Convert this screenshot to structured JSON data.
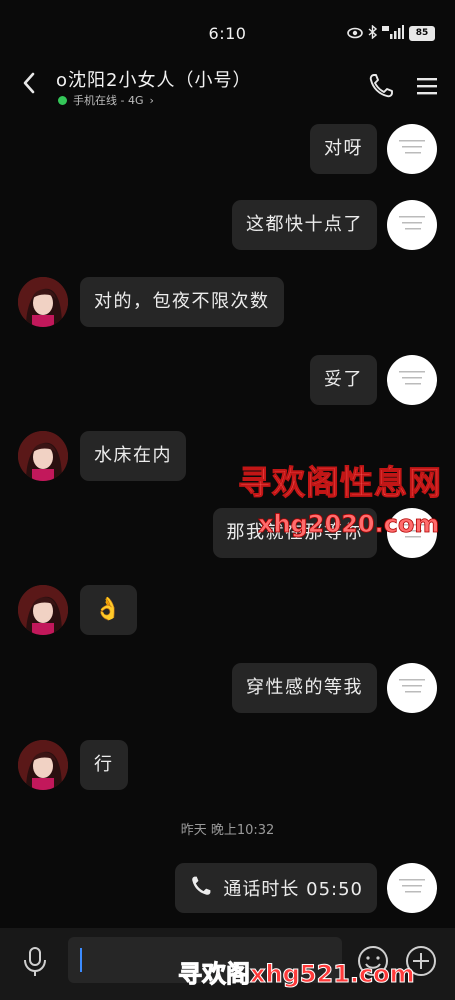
{
  "status_bar": {
    "time": "6:10",
    "battery": "85"
  },
  "header": {
    "title": "o沈阳2小女人（小号）",
    "subtitle": "手机在线 - 4G",
    "subtitle_chevron": "›"
  },
  "messages": [
    {
      "from": "me",
      "text": "对呀"
    },
    {
      "from": "me",
      "text": "这都快十点了"
    },
    {
      "from": "peer",
      "text": "对的，包夜不限次数"
    },
    {
      "from": "me",
      "text": "妥了"
    },
    {
      "from": "peer",
      "text": "水床在内"
    },
    {
      "from": "me",
      "text": "那我就在那等你"
    },
    {
      "from": "peer",
      "text": "👌"
    },
    {
      "from": "me",
      "text": "穿性感的等我"
    },
    {
      "from": "peer",
      "text": "行"
    }
  ],
  "time_divider": "昨天 晚上10:32",
  "call_record": {
    "icon": "phone-call-icon",
    "label": "通话时长 05:50"
  },
  "input": {
    "value": ""
  },
  "watermarks": {
    "site_name": "寻欢阁性息网",
    "site_url": "xhg2020.com",
    "bottom_banner": "寻欢阁xhg521.com"
  },
  "icons": [
    "back-arrow-icon",
    "phone-icon",
    "menu-icon",
    "microphone-icon",
    "emoji-icon",
    "plus-icon",
    "eye-icon",
    "bluetooth-icon",
    "signal-icon"
  ],
  "colors": {
    "background": "#0a0a0a",
    "bubble": "#262626",
    "online": "#34c759",
    "watermark": "#ff5a5a"
  }
}
